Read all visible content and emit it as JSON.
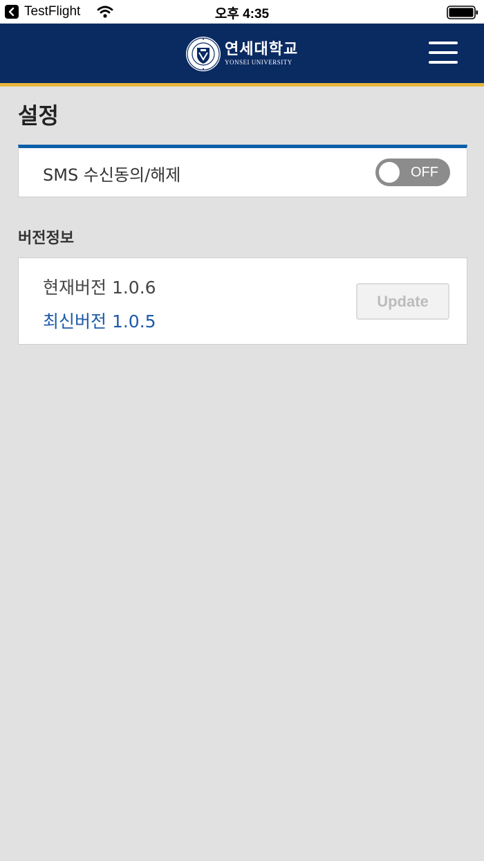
{
  "status_bar": {
    "back_app": "TestFlight",
    "time": "오후 4:35"
  },
  "header": {
    "logo_kr": "연세대학교",
    "logo_en": "YONSEI UNIVERSITY",
    "seal_ring_text": "YONSEI UNIVERSITY",
    "menu_icon": "hamburger-menu-icon"
  },
  "page": {
    "title": "설정"
  },
  "sms": {
    "label": "SMS 수신동의/해제",
    "toggle_state": "OFF"
  },
  "version_section": {
    "title": "버전정보",
    "current": "현재버전 1.0.6",
    "latest": "최신버전 1.0.5",
    "update_label": "Update"
  },
  "colors": {
    "header_bg": "#0a2a62",
    "accent_gold": "#e8b53a",
    "card_accent_blue": "#0a5fa8",
    "latest_text_blue": "#1d5aa8",
    "page_bg": "#e1e1e1"
  }
}
